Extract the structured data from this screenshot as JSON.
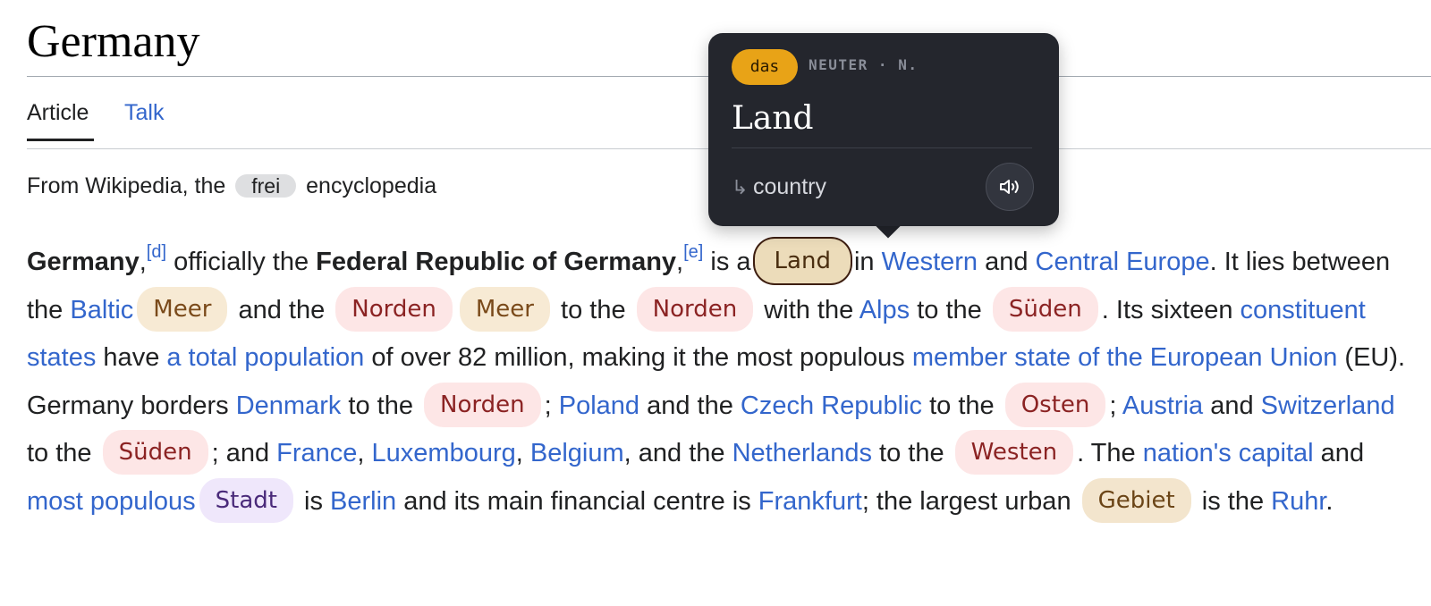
{
  "page": {
    "title": "Germany",
    "tabs": [
      "Article",
      "Talk"
    ],
    "tagline": {
      "prefix": "From Wikipedia, the",
      "chip": "frei",
      "suffix": "encyclopedia"
    }
  },
  "article": {
    "germany": "Germany",
    "comma1": ",",
    "ref_d": "[d]",
    "officially_the": " officially the ",
    "frg": "Federal Republic of Germany",
    "comma2": ",",
    "ref_e": "[e]",
    "is_a": " is a",
    "land": "Land",
    "in": "in ",
    "western": "Western",
    "and1": " and ",
    "central_europe": "Central Europe",
    "it_lies": ". It lies between the ",
    "baltic": "Baltic",
    "meer1": "Meer",
    "and_the1": " and the ",
    "norden1": "Norden",
    "meer2": "Meer",
    "to_the1": " to the ",
    "norden2": "Norden",
    "with_the": " with the ",
    "alps": "Alps",
    "to_the2": " to the ",
    "sueden1": "Süden",
    "its_sixteen": ". Its sixteen ",
    "constituent_states": "constituent states",
    "have": " have ",
    "total_population": "a total population",
    "of_over": " of over 82 million, making it the most populous ",
    "member_state": "member state of the European Union",
    "eu_borders": " (EU). Germany borders ",
    "denmark": "Denmark",
    "to_the3": " to the ",
    "norden3": "Norden",
    "semi1": "; ",
    "poland": "Poland",
    "and_the2": " and the ",
    "czech": "Czech Republic",
    "to_the4": " to the ",
    "osten": "Osten",
    "semi2": "; ",
    "austria": "Austria",
    "and2": " and ",
    "switzerland": "Switzerland",
    "to_the5": " to the ",
    "sueden2": "Süden",
    "semi_and": "; and ",
    "france": "France",
    "comma3": ", ",
    "luxembourg": "Luxembourg",
    "comma4": ", ",
    "belgium": "Belgium",
    "and_the3": ", and the ",
    "netherlands": "Netherlands",
    "to_the6": " to the ",
    "westen": "Westen",
    "the": ". The ",
    "capital": "nation's capital",
    "and3": " and ",
    "most_populous": "most populous",
    "stadt": "Stadt",
    "is": " is ",
    "berlin": "Berlin",
    "financial": " and its main financial centre is ",
    "frankfurt": "Frankfurt",
    "largest_urban": "; the largest urban ",
    "gebiet": "Gebiet",
    "is_the": " is the ",
    "ruhr": "Ruhr",
    "period": "."
  },
  "popover": {
    "article": "das",
    "meta": "NEUTER · N.",
    "word": "Land",
    "arrow": "↳",
    "translation": "country",
    "speaker_icon": "speaker-icon"
  },
  "colors": {
    "link": "#3366cc",
    "popover_bg": "#24262d",
    "article_badge": "#e8a317"
  }
}
